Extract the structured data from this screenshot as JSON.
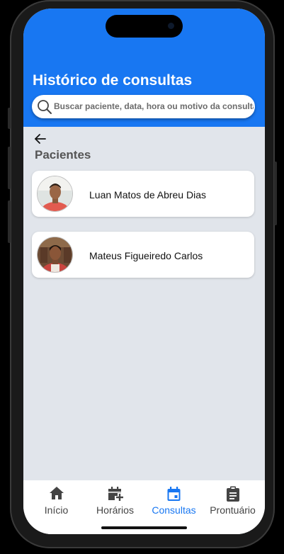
{
  "header": {
    "title": "Histórico de consultas",
    "search_placeholder": "Buscar paciente, data, hora ou motivo da consulta"
  },
  "section": {
    "title": "Pacientes"
  },
  "patients": [
    {
      "name": "Luan Matos de Abreu Dias"
    },
    {
      "name": "Mateus Figueiredo Carlos"
    }
  ],
  "tabs": [
    {
      "label": "Início",
      "icon": "home-icon",
      "active": false
    },
    {
      "label": "Horários",
      "icon": "calendar-plus-icon",
      "active": false
    },
    {
      "label": "Consultas",
      "icon": "calendar-icon",
      "active": true
    },
    {
      "label": "Prontuário",
      "icon": "clipboard-icon",
      "active": false
    }
  ],
  "colors": {
    "primary": "#1877f2",
    "background": "#e1e5eb",
    "tab_inactive": "#444444"
  }
}
